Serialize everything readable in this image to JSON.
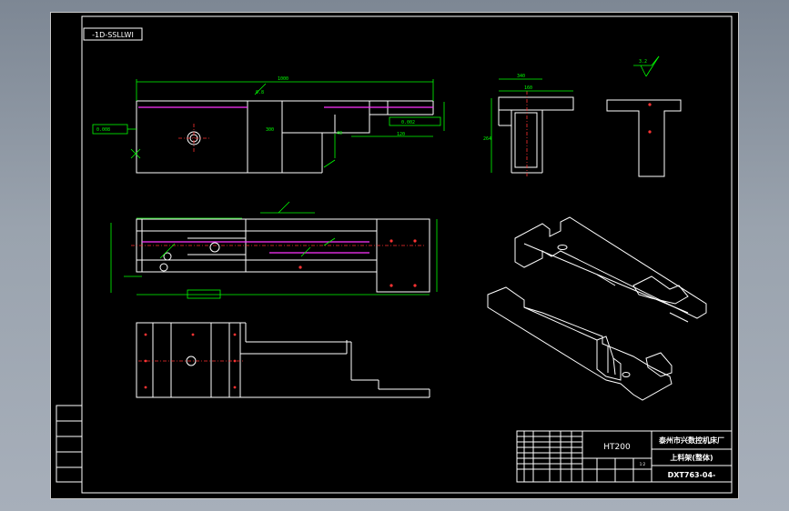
{
  "drawing": {
    "stamp_code": "-1D-SSLLWI",
    "material": "HT200",
    "company": "泰州市兴数控机床厂",
    "part_name": "上料架(整体)",
    "drawing_no": "DXT763-04-",
    "scale": "1:2"
  },
  "dimensions": {
    "front_total": "1000",
    "front_top": "0.8",
    "front_tol": "0.008",
    "front_right": "0.002",
    "front_d1": "300",
    "front_d2": "40",
    "front_d3": "120",
    "side_width": "340",
    "side_top": "160",
    "side_height": "264",
    "rough": "3.2"
  },
  "colors": {
    "sheet": "#000000",
    "lines": "#ffffff",
    "dims": "#00ff00",
    "center": "#ff3030",
    "hidden": "#ff33ff"
  }
}
